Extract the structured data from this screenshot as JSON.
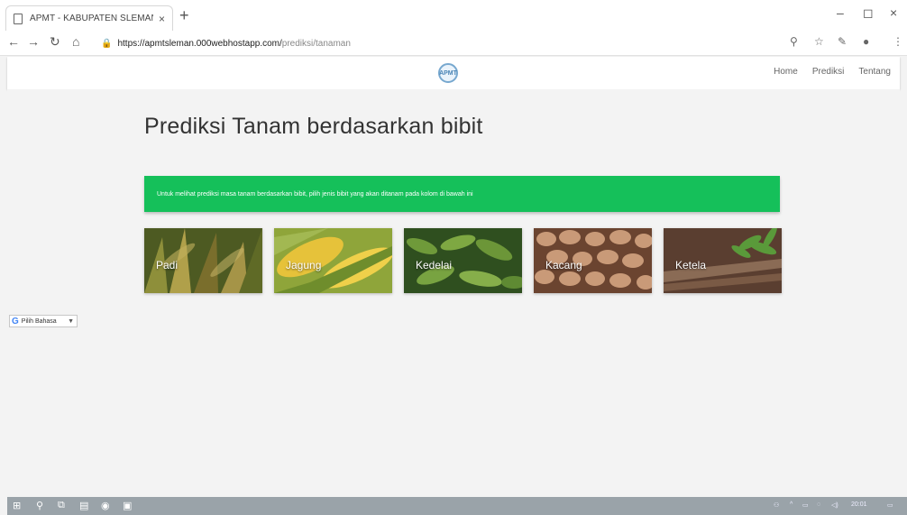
{
  "browser": {
    "tab_title": "APMT - KABUPATEN SLEMAN",
    "new_tab": "+",
    "url_host": "https://apmtsleman.000webhostapp.com/",
    "url_path": "prediksi/tanaman"
  },
  "site": {
    "logo_text": "APMT",
    "nav": [
      "Home",
      "Prediksi",
      "Tentang"
    ]
  },
  "page": {
    "title": "Prediksi Tanam berdasarkan bibit",
    "alert": "Untuk melihat prediksi masa tanam berdasarkan bibit, pilih jenis bibit yang akan ditanam pada kolom di bawah ini",
    "cards": [
      {
        "label": "Padi",
        "color": "#6d7a2c"
      },
      {
        "label": "Jagung",
        "color": "#c8a62a"
      },
      {
        "label": "Kedelai",
        "color": "#3f6a2a"
      },
      {
        "label": "Kacang",
        "color": "#8a5a3c"
      },
      {
        "label": "Ketela",
        "color": "#7a5a45"
      }
    ],
    "translate": "Pilih Bahasa"
  },
  "taskbar": {
    "clock": "20:01"
  }
}
